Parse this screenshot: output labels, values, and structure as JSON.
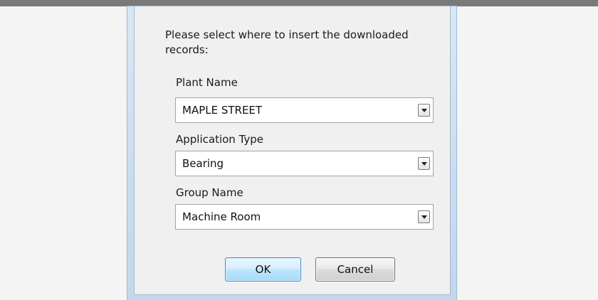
{
  "dialog": {
    "prompt": "Please select where to insert the downloaded records:",
    "fields": [
      {
        "label": "Plant Name",
        "value": "MAPLE STREET",
        "arrow_icon": "dropdown-arrow-icon"
      },
      {
        "label": "Application Type",
        "value": "Bearing",
        "arrow_icon": "dropdown-arrow-icon"
      },
      {
        "label": "Group Name",
        "value": "Machine Room",
        "arrow_icon": "dropdown-arrow-icon"
      }
    ],
    "buttons": {
      "ok_label": "OK",
      "cancel_label": "Cancel"
    }
  },
  "colors": {
    "frame": "#c9dcef",
    "body": "#f0f0f0",
    "ok_border": "#3c8fd6",
    "top_strip": "#7a7a7a"
  }
}
